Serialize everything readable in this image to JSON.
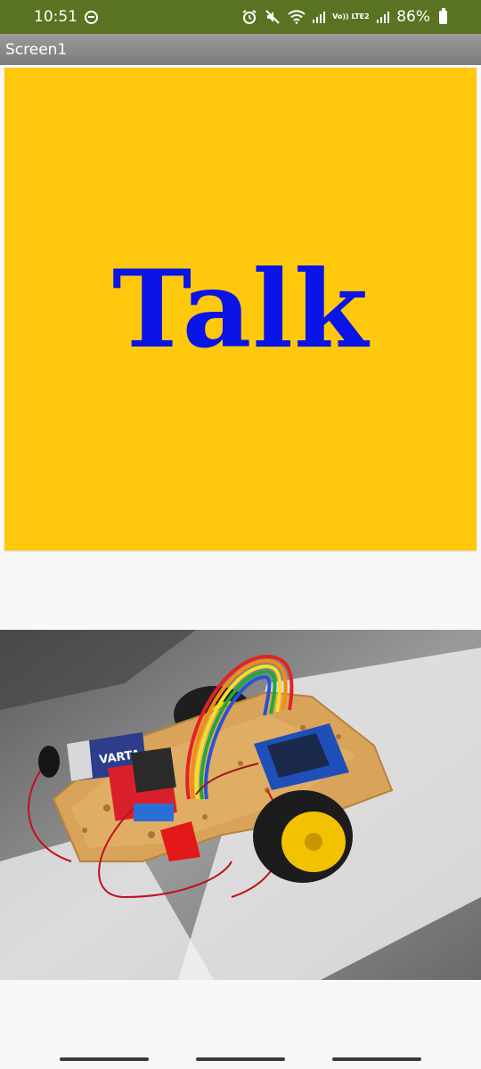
{
  "status_bar": {
    "time": "10:51",
    "volte_label": "Vo)) LTE2",
    "battery_percent": "86%"
  },
  "screen": {
    "title": "Screen1"
  },
  "talk_button": {
    "label": "Talk",
    "background": "#fec90c",
    "text_color": "#0a14e6"
  },
  "robot_image": {
    "battery_brand": "VARTA"
  }
}
